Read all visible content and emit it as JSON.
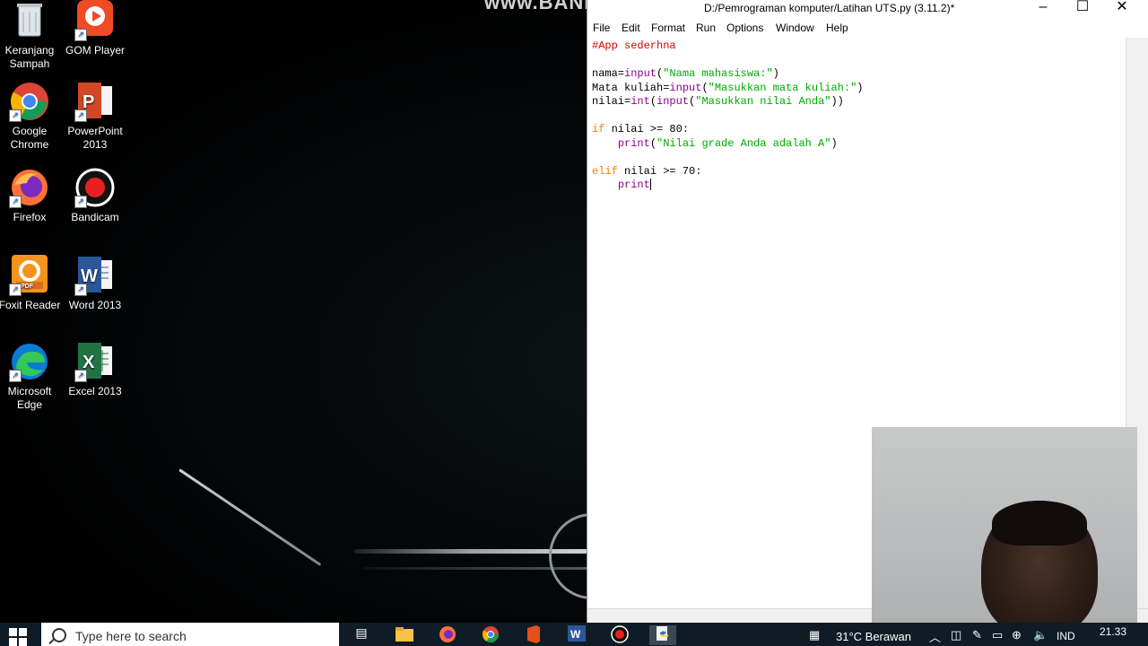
{
  "watermark": "www.BANDICAM.com",
  "desktop_icons": [
    {
      "label": "Keranjang Sampah",
      "name": "recycle-bin"
    },
    {
      "label": "GOM Player",
      "name": "gom-player"
    },
    {
      "label": "Google Chrome",
      "name": "google-chrome"
    },
    {
      "label": "PowerPoint 2013",
      "name": "powerpoint-2013"
    },
    {
      "label": "Firefox",
      "name": "firefox"
    },
    {
      "label": "Bandicam",
      "name": "bandicam"
    },
    {
      "label": "Foxit Reader",
      "name": "foxit-reader"
    },
    {
      "label": "Word 2013",
      "name": "word-2013"
    },
    {
      "label": "Microsoft Edge",
      "name": "microsoft-edge"
    },
    {
      "label": "Excel 2013",
      "name": "excel-2013"
    }
  ],
  "idle": {
    "title": "D:/Pemrograman komputer/Latihan UTS.py (3.11.2)*",
    "menu": [
      "File",
      "Edit",
      "Format",
      "Run",
      "Options",
      "Window",
      "Help"
    ],
    "code": [
      [
        {
          "t": "#App sederhna",
          "c": "cm"
        }
      ],
      [],
      [
        {
          "t": "nama=",
          "c": "df"
        },
        {
          "t": "input",
          "c": "bi"
        },
        {
          "t": "(",
          "c": "df"
        },
        {
          "t": "\"Nama mahasiswa:\"",
          "c": "st"
        },
        {
          "t": ")",
          "c": "df"
        }
      ],
      [
        {
          "t": "Mata kuliah=",
          "c": "df"
        },
        {
          "t": "input",
          "c": "bi"
        },
        {
          "t": "(",
          "c": "df"
        },
        {
          "t": "\"Masukkan mata kuliah:\"",
          "c": "st"
        },
        {
          "t": ")",
          "c": "df"
        }
      ],
      [
        {
          "t": "nilai=",
          "c": "df"
        },
        {
          "t": "int",
          "c": "bi"
        },
        {
          "t": "(",
          "c": "df"
        },
        {
          "t": "input",
          "c": "bi"
        },
        {
          "t": "(",
          "c": "df"
        },
        {
          "t": "\"Masukkan nilai Anda\"",
          "c": "st"
        },
        {
          "t": "))",
          "c": "df"
        }
      ],
      [],
      [
        {
          "t": "if",
          "c": "kw"
        },
        {
          "t": " nilai >= 80:",
          "c": "df"
        }
      ],
      [
        {
          "t": "    ",
          "c": "df"
        },
        {
          "t": "print",
          "c": "bi"
        },
        {
          "t": "(",
          "c": "df"
        },
        {
          "t": "\"Nilai grade Anda adalah A\"",
          "c": "st"
        },
        {
          "t": ")",
          "c": "df"
        }
      ],
      [],
      [
        {
          "t": "elif",
          "c": "kw"
        },
        {
          "t": " nilai >= 70:",
          "c": "df"
        }
      ],
      [
        {
          "t": "    ",
          "c": "df"
        },
        {
          "t": "print",
          "c": "bi"
        }
      ]
    ]
  },
  "taskbar": {
    "search_placeholder": "Type here to search",
    "weather": "31°C  Berawan",
    "lang": "IND",
    "time": "21.33"
  }
}
